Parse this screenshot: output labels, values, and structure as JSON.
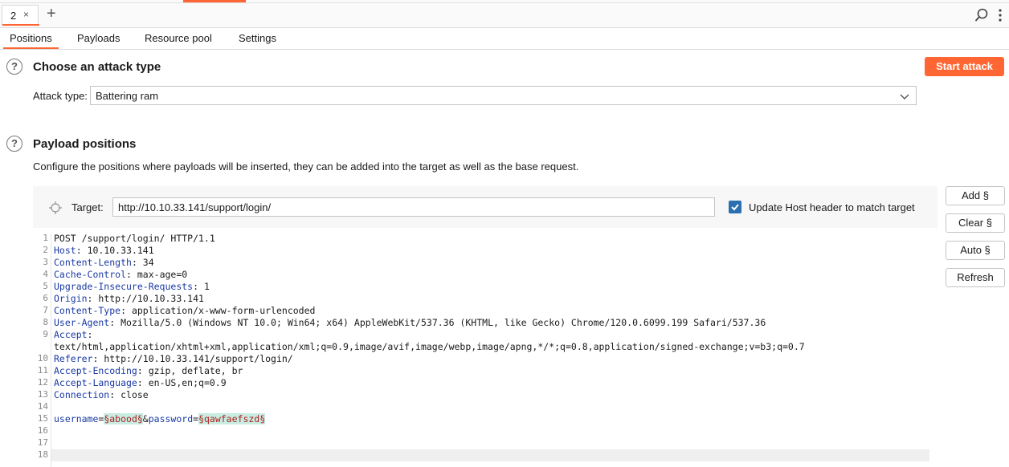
{
  "top_tabs": [
    {
      "label": "2",
      "close": "×"
    }
  ],
  "add_tab": "+",
  "subtabs": [
    "Positions",
    "Payloads",
    "Resource pool",
    "Settings"
  ],
  "attack_section": {
    "title": "Choose an attack type",
    "start_button": "Start attack",
    "attack_type_label": "Attack type:",
    "attack_type_value": "Battering ram"
  },
  "payload_section": {
    "title": "Payload positions",
    "description": "Configure the positions where payloads will be inserted, they can be added into the target as well as the base request.",
    "target_label": "Target:",
    "target_value": "http://10.10.33.141/support/login/",
    "update_host_label": "Update Host header to match target",
    "update_host_checked": true
  },
  "side_buttons": [
    "Add §",
    "Clear §",
    "Auto §",
    "Refresh"
  ],
  "request": {
    "line_numbers": [
      "1",
      "2",
      "3",
      "4",
      "5",
      "6",
      "7",
      "8",
      "9",
      "",
      "10",
      "11",
      "12",
      "13",
      "14",
      "15",
      "16",
      "17",
      "18"
    ],
    "request_line": "POST /support/login/ HTTP/1.1",
    "headers": [
      {
        "name": "Host",
        "value": " 10.10.33.141"
      },
      {
        "name": "Content-Length",
        "value": " 34"
      },
      {
        "name": "Cache-Control",
        "value": " max-age=0"
      },
      {
        "name": "Upgrade-Insecure-Requests",
        "value": " 1"
      },
      {
        "name": "Origin",
        "value": " http://10.10.33.141"
      },
      {
        "name": "Content-Type",
        "value": " application/x-www-form-urlencoded"
      },
      {
        "name": "User-Agent",
        "value": " Mozilla/5.0 (Windows NT 10.0; Win64; x64) AppleWebKit/537.36 (KHTML, like Gecko) Chrome/120.0.6099.199 Safari/537.36"
      },
      {
        "name": "Accept",
        "value": ""
      },
      {
        "name": "Referer",
        "value": " http://10.10.33.141/support/login/"
      },
      {
        "name": "Accept-Encoding",
        "value": " gzip, deflate, br"
      },
      {
        "name": "Accept-Language",
        "value": " en-US,en;q=0.9"
      },
      {
        "name": "Connection",
        "value": " close"
      }
    ],
    "accept_wrapped": "text/html,application/xhtml+xml,application/xml;q=0.9,image/avif,image/webp,image/apng,*/*;q=0.8,application/signed-exchange;v=b3;q=0.7",
    "body": {
      "p1_name": "username",
      "eq": "=",
      "p1_marker": "§abood§",
      "amp": "&",
      "p2_name": "password",
      "p2_marker": "§qawfaefszd§"
    }
  },
  "colors": {
    "accent": "#ff6633",
    "checkbox": "#2a6fb0",
    "header_name": "#1a3aa6",
    "marker_bg": "#c8ece2"
  },
  "icons": [
    "close-icon",
    "plus-icon",
    "search-icon",
    "more-vertical-icon",
    "help-icon",
    "chevron-down-icon",
    "crosshair-icon",
    "check-icon"
  ]
}
